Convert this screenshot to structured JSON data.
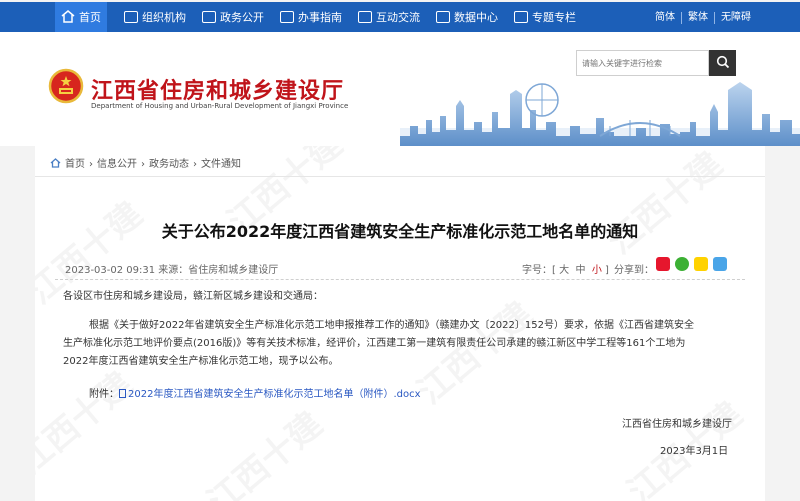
{
  "nav": {
    "items": [
      {
        "label": "首页",
        "icon": "home-icon",
        "active": true
      },
      {
        "label": "组织机构",
        "icon": "organization-icon"
      },
      {
        "label": "政务公开",
        "icon": "document-icon"
      },
      {
        "label": "办事指南",
        "icon": "id-card-icon"
      },
      {
        "label": "互动交流",
        "icon": "chat-icon"
      },
      {
        "label": "数据中心",
        "icon": "chart-icon"
      },
      {
        "label": "专题专栏",
        "icon": "folder-icon"
      }
    ],
    "lang": [
      "简体",
      "繁体",
      "无障碍"
    ]
  },
  "header": {
    "title": "江西省住房和城乡建设厅",
    "subtitle": "Department of Housing and Urban-Rural Development of Jiangxi Province",
    "search_placeholder": "请输入关键字进行检索"
  },
  "breadcrumb": [
    "首页",
    "›",
    "信息公开",
    "›",
    "政务动态",
    "›",
    "文件通知"
  ],
  "article": {
    "title": "关于公布2022年度江西省建筑安全生产标准化示范工地名单的通知",
    "meta": "2023-03-02 09:31  来源：省住房和城乡建设厅",
    "font_label": "字号：",
    "font_large": "大",
    "font_medium": "中",
    "font_small": "小",
    "share_label": "分享到：",
    "salutation": "各设区市住房和城乡建设局，赣江新区城乡建设和交通局：",
    "body_line1": "根据《关于做好2022年省建筑安全生产标准化示范工地申报推荐工作的通知》（赣建办文〔2022〕152号）要求，依据《江西省建筑安全",
    "body_line2": "生产标准化示范工地评价要点(2016版)》等有关技术标准，经评价，江西建工第一建筑有限责任公司承建的赣江新区中学工程等161个工地为",
    "body_line3": "2022年度江西省建筑安全生产标准化示范工地，现予以公布。",
    "attachment_label": "附件：",
    "attachment_name": "2022年度江西省建筑安全生产标准化示范工地名单（附件）.docx",
    "signature": "江西省住房和城乡建设厅",
    "date": "2023年3月1日"
  },
  "watermark": "江西十建",
  "colors": {
    "nav": "#1c5fb8",
    "nav_active": "#2f7be0",
    "title_red": "#c0141a",
    "link": "#2a58c2"
  }
}
